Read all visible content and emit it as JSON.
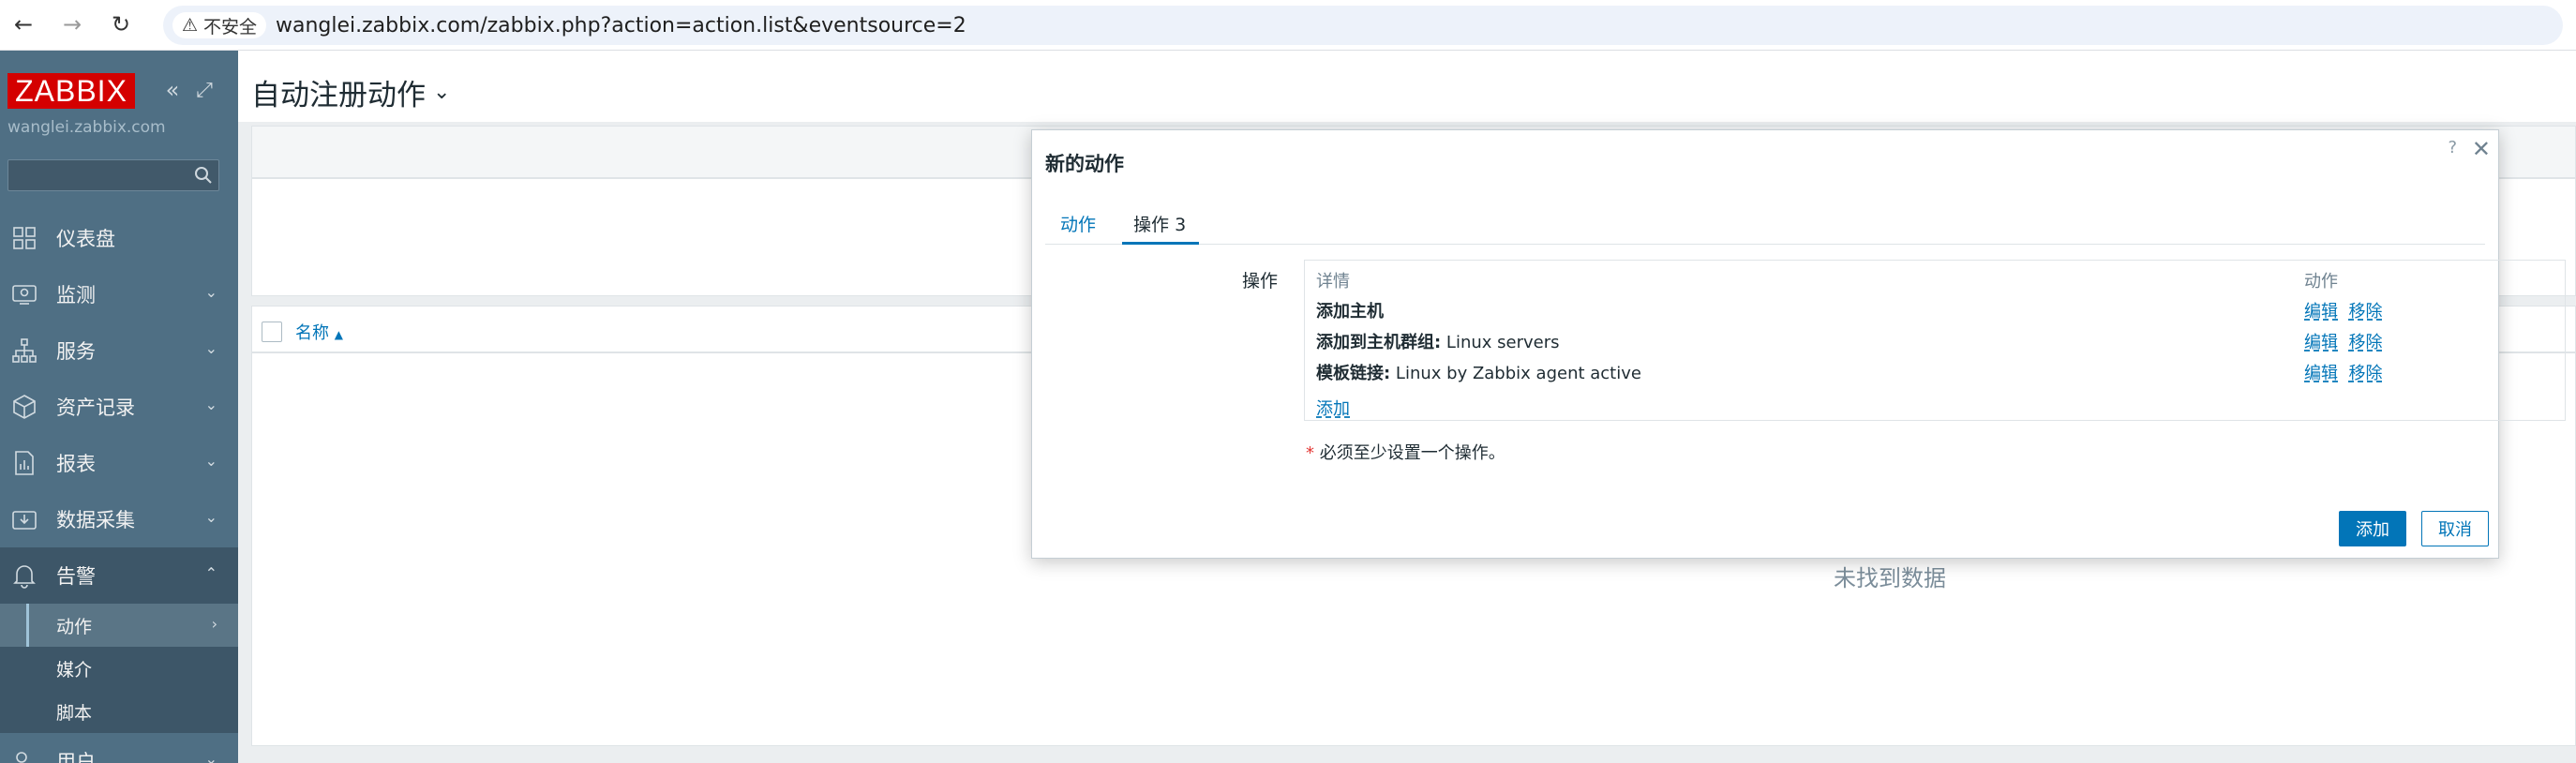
{
  "browser": {
    "back_icon": "arrow-left-icon",
    "forward_icon": "arrow-right-icon",
    "reload_icon": "reload-icon",
    "security_label": "不安全",
    "url": "wanglei.zabbix.com/zabbix.php?action=action.list&eventsource=2"
  },
  "sidebar": {
    "logo": "ZABBIX",
    "server_name": "wanglei.zabbix.com",
    "search_placeholder": "",
    "menu": [
      {
        "label": "仪表盘",
        "icon": "dashboard-icon"
      },
      {
        "label": "监测",
        "icon": "monitoring-icon"
      },
      {
        "label": "服务",
        "icon": "services-icon"
      },
      {
        "label": "资产记录",
        "icon": "inventory-icon"
      },
      {
        "label": "报表",
        "icon": "reports-icon"
      },
      {
        "label": "数据采集",
        "icon": "data-collection-icon"
      },
      {
        "label": "告警",
        "icon": "bell-icon"
      }
    ],
    "submenu": [
      {
        "label": "动作"
      },
      {
        "label": "媒介"
      },
      {
        "label": "脚本"
      }
    ],
    "next_menu": {
      "label": "用户",
      "icon": "users-icon"
    }
  },
  "main": {
    "page_title": "自动注册动作",
    "table": {
      "name_column": "名称",
      "no_data": "未找到数据"
    }
  },
  "modal": {
    "title": "新的动作",
    "help": "?",
    "tabs": [
      {
        "label": "动作"
      },
      {
        "label": "操作",
        "count": "3"
      }
    ],
    "operations_label": "操作",
    "columns": {
      "details": "详情",
      "actions": "动作"
    },
    "rows": [
      {
        "bold": "添加主机",
        "text": ""
      },
      {
        "bold": "添加到主机群组:",
        "text": " Linux servers"
      },
      {
        "bold": "模板链接:",
        "text": " Linux by Zabbix agent active"
      }
    ],
    "edit_label": "编辑",
    "remove_label": "移除",
    "add_link": "添加",
    "required_note": "必须至少设置一个操作。",
    "add_button": "添加",
    "cancel_button": "取消"
  }
}
